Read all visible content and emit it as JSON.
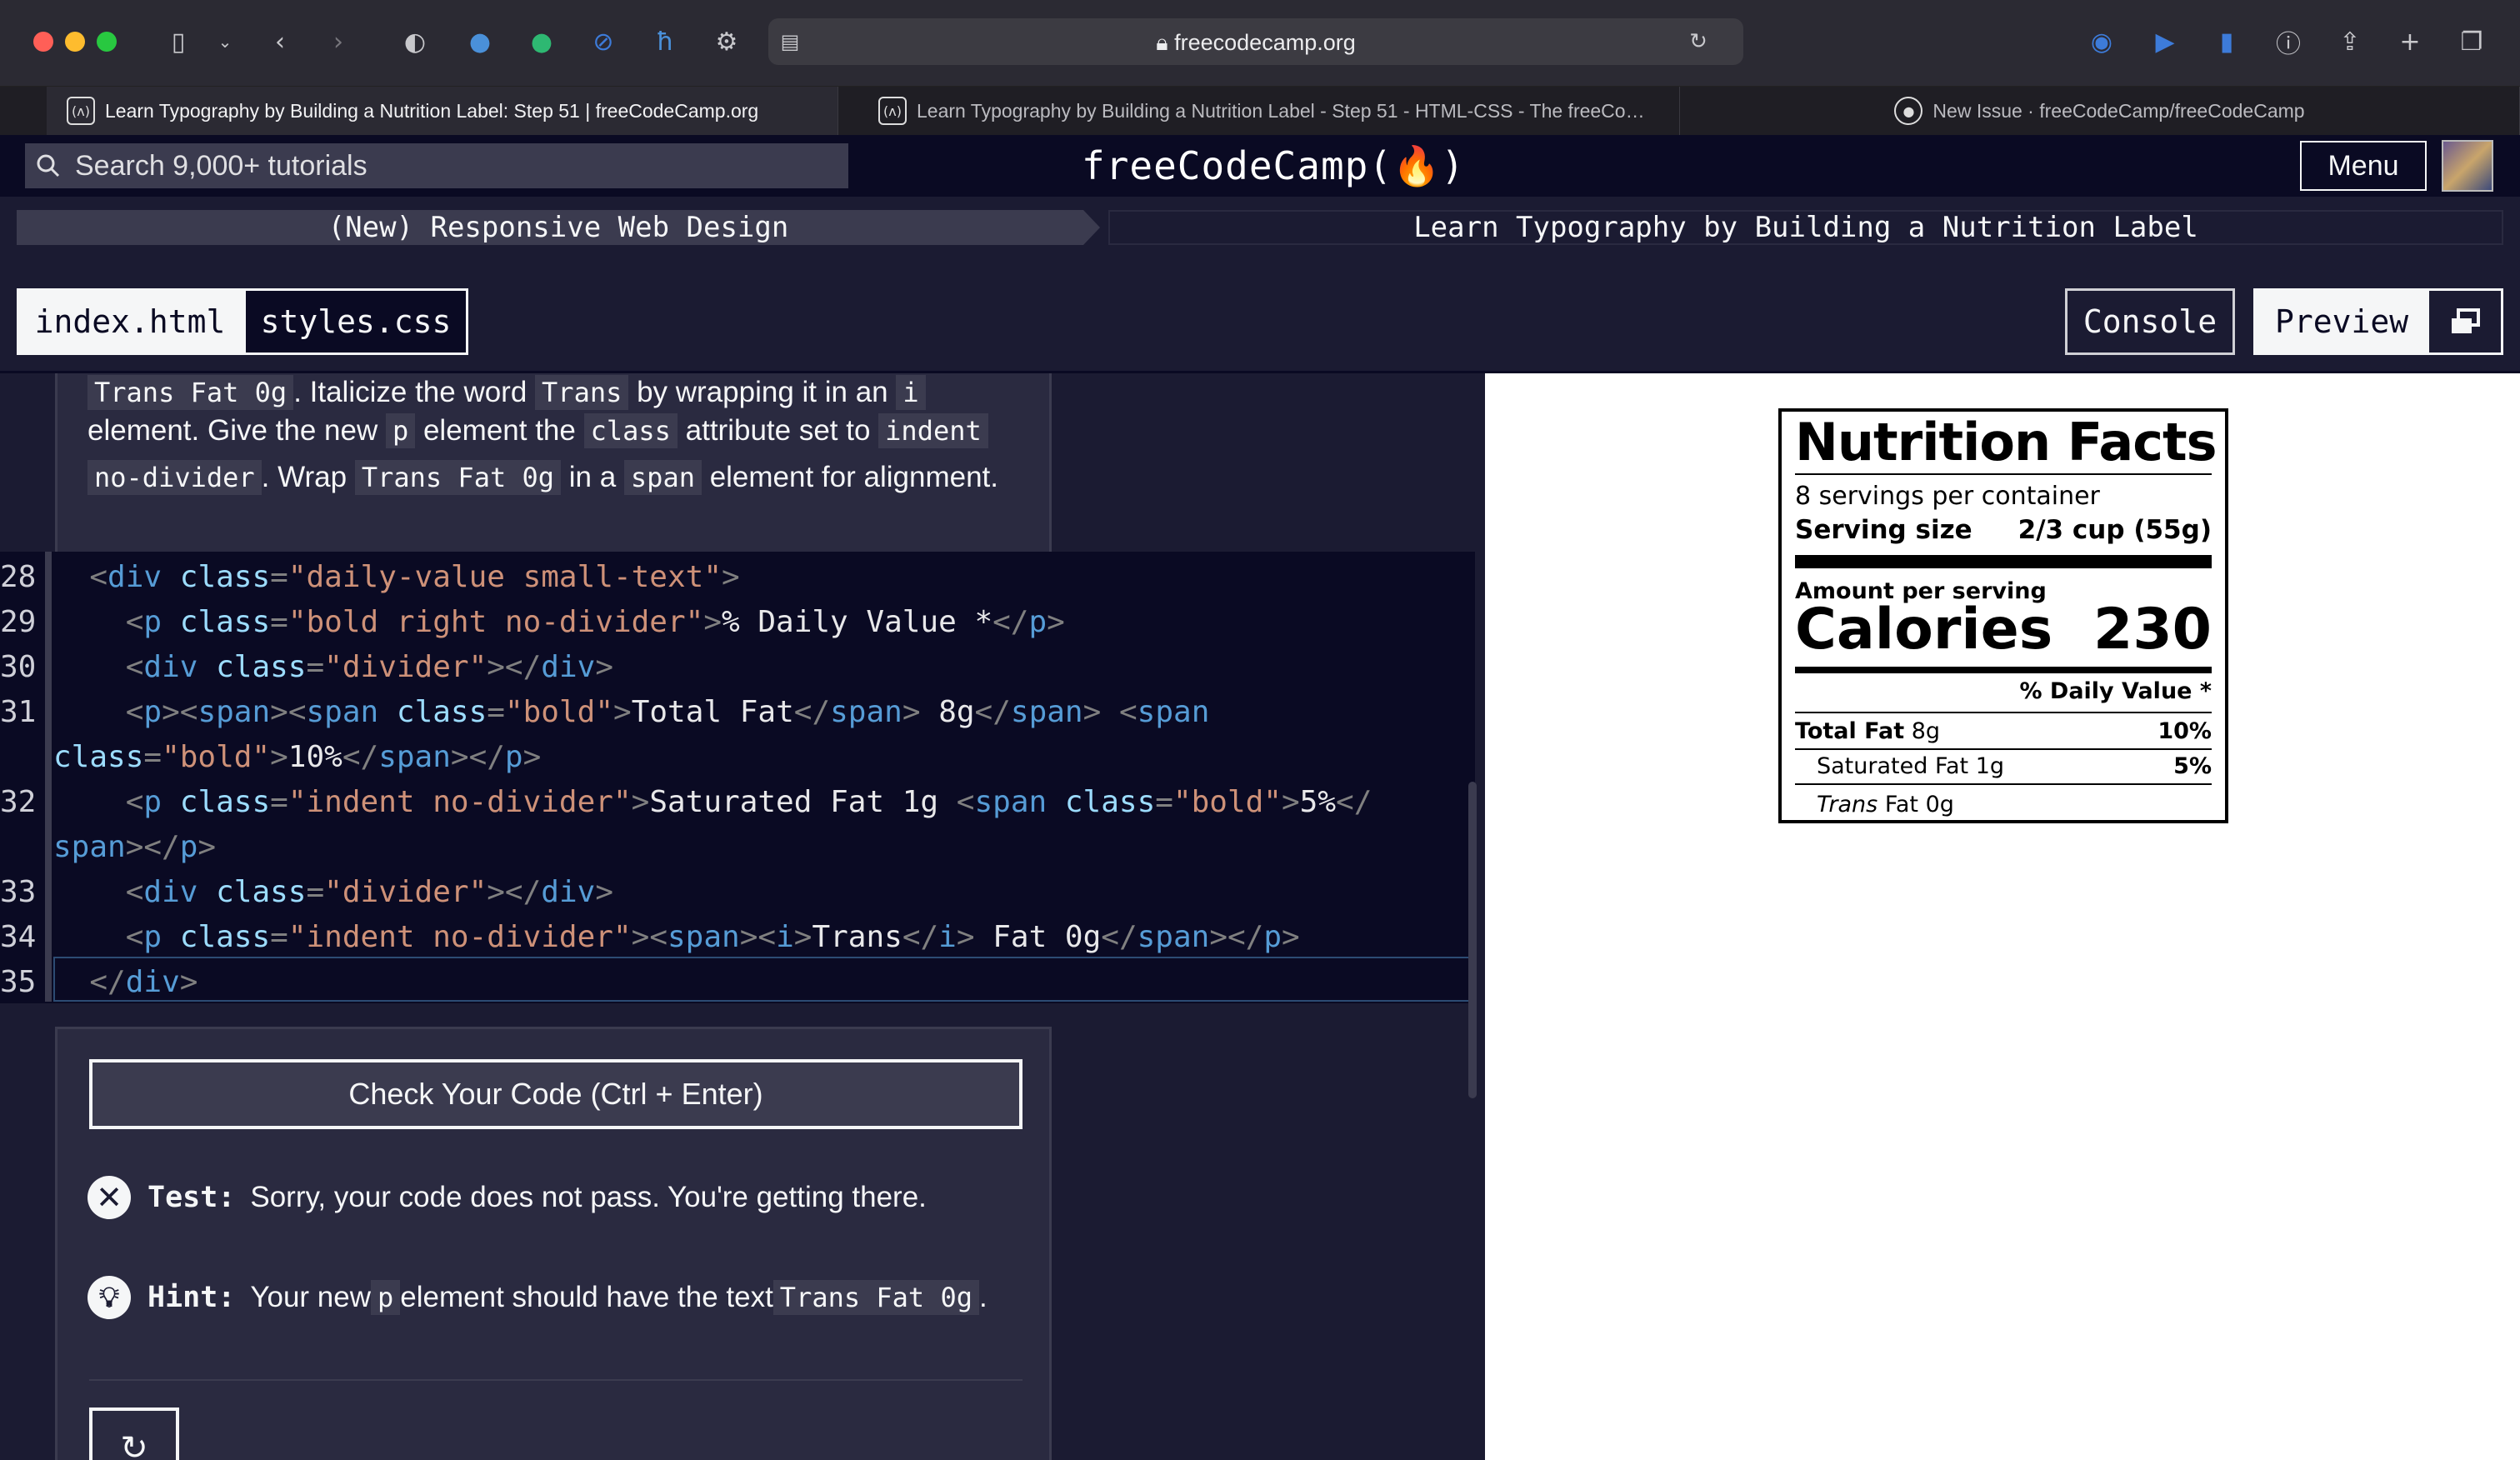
{
  "browser": {
    "url": "freecodecamp.org",
    "tabs": [
      {
        "title": "Learn Typography by Building a Nutrition Label: Step 51 | freeCodeCamp.org",
        "active": true
      },
      {
        "title": "Learn Typography by Building a Nutrition Label - Step 51 - HTML-CSS - The freeCo…",
        "active": false
      },
      {
        "title": "New Issue · freeCodeCamp/freeCodeCamp",
        "active": false
      }
    ]
  },
  "nav": {
    "search_placeholder": "Search 9,000+ tutorials",
    "logo": "freeCodeCamp(🔥)",
    "menu": "Menu"
  },
  "breadcrumb": {
    "course": "(New) Responsive Web Design",
    "project": "Learn Typography by Building a Nutrition Label"
  },
  "toolbar": {
    "file_tabs": [
      "index.html",
      "styles.css"
    ],
    "console": "Console",
    "preview": "Preview"
  },
  "instructions": {
    "line1": {
      "code1": "Trans Fat 0g",
      "text1": ". Italicize the word ",
      "code2": "Trans",
      "text2": " by wrapping it in an ",
      "code3": "i"
    },
    "line2": {
      "text1": "element. Give the new ",
      "code1": "p",
      "text2": " element the ",
      "code2": "class",
      "text3": " attribute set to ",
      "code3": "indent"
    },
    "line3": {
      "code1": "no-divider",
      "text1": ". Wrap ",
      "code2": "Trans Fat 0g",
      "text2": " in a ",
      "code3": "span",
      "text3": " element for alignment."
    }
  },
  "code": {
    "line_numbers": [
      "28",
      "29",
      "30",
      "31",
      "32",
      "33",
      "34",
      "35"
    ]
  },
  "tests": {
    "check_button": "Check Your Code (Ctrl + Enter)",
    "test_label": "Test:",
    "test_text": "Sorry, your code does not pass. You're getting there.",
    "hint_label": "Hint:",
    "hint_text1": "Your new ",
    "hint_code1": "p",
    "hint_text2": " element should have the text ",
    "hint_code2": "Trans Fat 0g",
    "hint_text3": "."
  },
  "nutrition": {
    "title": "Nutrition Facts",
    "servings": "8 servings per container",
    "serving_size_label": "Serving size",
    "serving_size_value": "2/3 cup (55g)",
    "amount_per_serving": "Amount per serving",
    "calories_label": "Calories",
    "calories_value": "230",
    "daily_value": "% Daily Value *",
    "total_fat_label": "Total Fat",
    "total_fat_amount": " 8g",
    "total_fat_pct": "10%",
    "sat_fat": "Saturated Fat 1g",
    "sat_fat_pct": "5%",
    "trans_italic": "Trans",
    "trans_rest": " Fat 0g"
  }
}
